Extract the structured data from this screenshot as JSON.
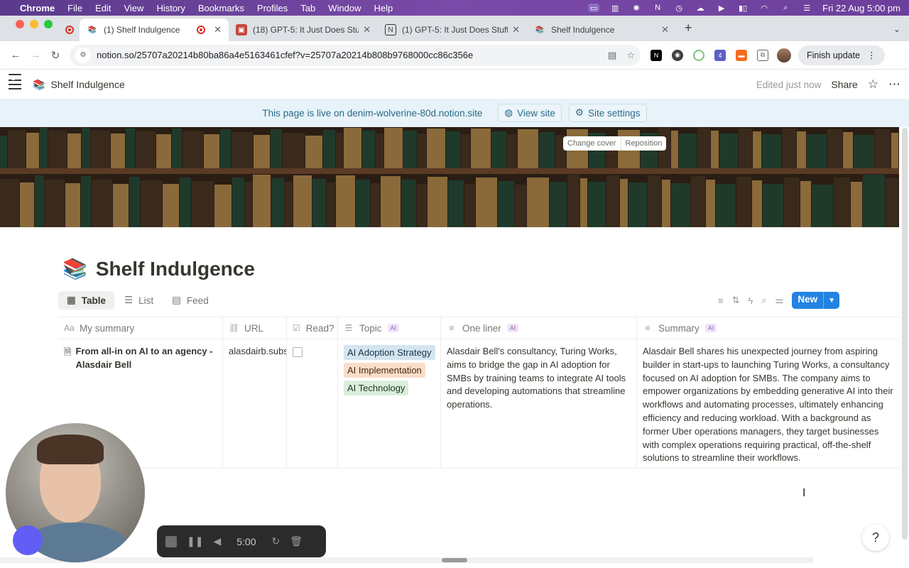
{
  "menubar": {
    "app": "Chrome",
    "items": [
      "File",
      "Edit",
      "View",
      "History",
      "Bookmarks",
      "Profiles",
      "Tab",
      "Window",
      "Help"
    ],
    "clock": "Fri 22 Aug  5:00 pm"
  },
  "tabs": [
    {
      "title": "(1) Shelf Indulgence",
      "active": true
    },
    {
      "title": "(18) GPT-5: It Just Does Stuff"
    },
    {
      "title": "(1) GPT-5: It Just Does Stuff"
    },
    {
      "title": "Shelf Indulgence"
    }
  ],
  "toolbar": {
    "url": "notion.so/25707a20214b80ba86a4e5163461cfef?v=25707a20214b808b9768000cc86c356e",
    "finish_update": "Finish update"
  },
  "notion": {
    "notification_count": "1",
    "breadcrumb": "Shelf Indulgence",
    "edited": "Edited just now",
    "share": "Share"
  },
  "banner": {
    "message": "This page is live on denim-wolverine-80d.notion.site",
    "view_site": "View site",
    "site_settings": "Site settings"
  },
  "cover": {
    "change_cover": "Change cover",
    "reposition": "Reposition"
  },
  "page": {
    "title": "Shelf Indulgence",
    "emoji": "📚"
  },
  "views": {
    "items": [
      "Table",
      "List",
      "Feed"
    ],
    "new": "New"
  },
  "table": {
    "headers": {
      "summary": "My summary",
      "url": "URL",
      "read": "Read?",
      "topic": "Topic",
      "one_liner": "One liner",
      "summary_ai": "Summary",
      "ai_badge": "AI"
    },
    "rows": [
      {
        "name": "From all-in on AI to an agency - Alasdair Bell",
        "url": "alasdairb.substack.com",
        "read": false,
        "topics": [
          "AI Adoption Strategy",
          "AI Implementation",
          "AI Technology"
        ],
        "one_liner": "Alasdair Bell's consultancy, Turing Works, aims to bridge the gap in AI adoption for SMBs by training teams to integrate AI tools and developing automations that streamline operations.",
        "summary": "Alasdair Bell shares his unexpected journey from aspiring builder in start-ups to launching Turing Works, a consultancy focused on AI adoption for SMBs. The company aims to empower organizations by embedding generative AI into their workflows and automating processes, ultimately enhancing efficiency and reducing workload. With a background as former Uber operations managers, they target businesses with complex operations requiring practical, off-the-shelf solutions to streamline their workflows."
      }
    ]
  },
  "recorder": {
    "time": "5:00"
  },
  "colors": {
    "accent": "#2383e2",
    "tag_blue": "#d3e5ef",
    "tag_orange": "#fadec9",
    "tag_green": "#dbeddb",
    "banner_bg": "#e7f3f8"
  }
}
